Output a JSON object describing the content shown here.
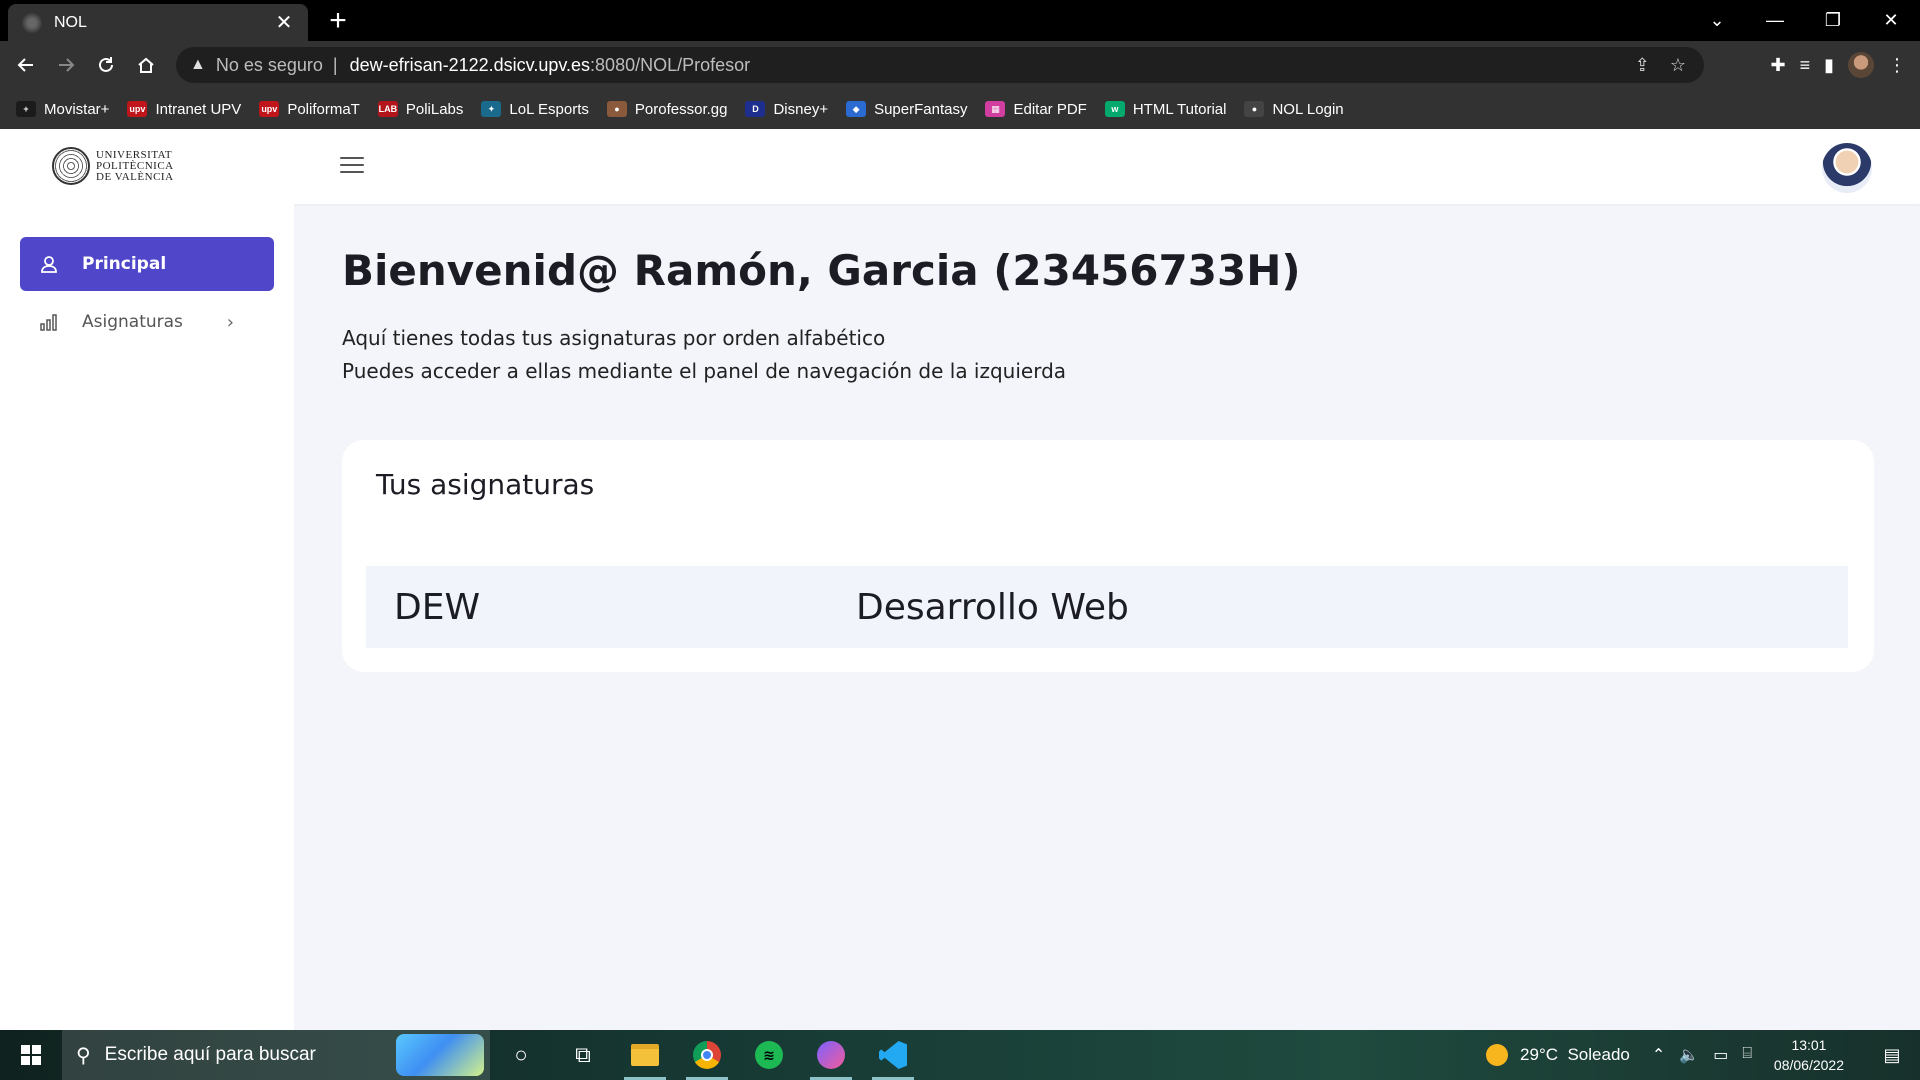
{
  "browser": {
    "tab_title": "NOL",
    "tab_close": "✕",
    "new_tab": "+",
    "win_minimize": "—",
    "win_restore": "❐",
    "win_close": "✕",
    "win_tabsearch": "⌄",
    "address": {
      "insecure_label": "No es seguro",
      "separator": "|",
      "host": "dew-efrisan-2122.dsicv.upv.es",
      "path": ":8080/NOL/Profesor"
    },
    "bookmarks": [
      {
        "label": "Movistar+",
        "icon_color": "#1b1b1b",
        "icon_text": "+"
      },
      {
        "label": "Intranet UPV",
        "icon_color": "#c0151b",
        "icon_text": "upv"
      },
      {
        "label": "PoliformaT",
        "icon_color": "#c0151b",
        "icon_text": "upv"
      },
      {
        "label": "PoliLabs",
        "icon_color": "#b3151b",
        "icon_text": "LAB"
      },
      {
        "label": "LoL Esports",
        "icon_color": "#1a6a8e",
        "icon_text": "✦"
      },
      {
        "label": "Porofessor.gg",
        "icon_color": "#8b5a3c",
        "icon_text": "●"
      },
      {
        "label": "Disney+",
        "icon_color": "#1e2e8f",
        "icon_text": "D"
      },
      {
        "label": "SuperFantasy",
        "icon_color": "#2a6ad1",
        "icon_text": "◆"
      },
      {
        "label": "Editar PDF",
        "icon_color": "#d23ea0",
        "icon_text": "▦"
      },
      {
        "label": "HTML Tutorial",
        "icon_color": "#04aa6d",
        "icon_text": "w"
      },
      {
        "label": "NOL Login",
        "icon_color": "#444444",
        "icon_text": "●"
      }
    ]
  },
  "header": {
    "logo_line1": "UNIVERSITAT",
    "logo_line2": "POLITÈCNICA",
    "logo_line3": "DE VALÈNCIA"
  },
  "sidebar": {
    "items": [
      {
        "label": "Principal",
        "active": true
      },
      {
        "label": "Asignaturas",
        "active": false,
        "chevron": "›"
      }
    ]
  },
  "main": {
    "welcome": "Bienvenid@ Ramón, Garcia (23456733H)",
    "intro_line1": "Aquí tienes todas tus asignaturas por orden alfabético",
    "intro_line2": "Puedes acceder a ellas mediante el panel de navegación de la izquierda",
    "card_title": "Tus asignaturas",
    "subjects": [
      {
        "code": "DEW",
        "name": "Desarrollo Web"
      }
    ]
  },
  "taskbar": {
    "search_placeholder": "Escribe aquí para buscar",
    "weather_temp": "29°C",
    "weather_desc": "Soleado",
    "time": "13:01",
    "date": "08/06/2022"
  },
  "colors": {
    "accent": "#5046c9",
    "page_bg": "#f3f5fb",
    "row_bg": "#f1f4fb"
  }
}
